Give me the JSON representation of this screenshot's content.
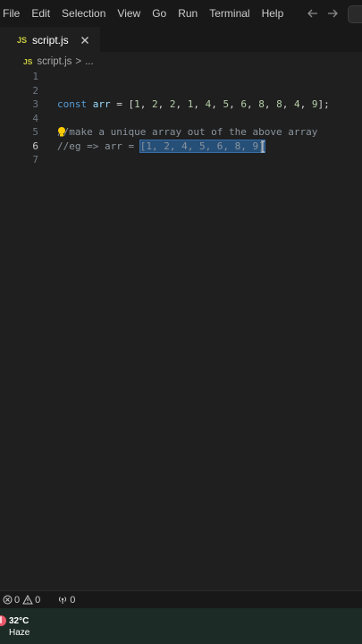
{
  "menu": [
    "File",
    "Edit",
    "Selection",
    "View",
    "Go",
    "Run",
    "Terminal",
    "Help"
  ],
  "tab": {
    "badge": "JS",
    "label": "script.js"
  },
  "breadcrumb": {
    "badge": "JS",
    "file": "script.js",
    "sep": ">",
    "more": "..."
  },
  "editor": {
    "line_numbers": [
      "1",
      "2",
      "3",
      "4",
      "5",
      "6",
      "7"
    ],
    "active_line": "6",
    "line3": {
      "kw": "const",
      "var": "arr",
      "eq": " = ",
      "open": "[",
      "nums": [
        "1",
        "2",
        "2",
        "1",
        "4",
        "5",
        "6",
        "8",
        "8",
        "4",
        "9"
      ],
      "close": "];"
    },
    "line5": {
      "text": "//make a unique array out of the above array"
    },
    "line6": {
      "prefix": "//eg => arr = ",
      "selected": "[1, 2, 4, 5, 6, 8, 9]"
    }
  },
  "status": {
    "errors": "0",
    "warnings": "0",
    "ports": "0"
  },
  "weather": {
    "temp": "32°C",
    "desc": "Haze"
  },
  "colors": {
    "background": "#1f1f1f",
    "keyword": "#569cd6",
    "variable": "#9cdcfe",
    "number": "#b5cea8",
    "selection": "#264f78"
  }
}
